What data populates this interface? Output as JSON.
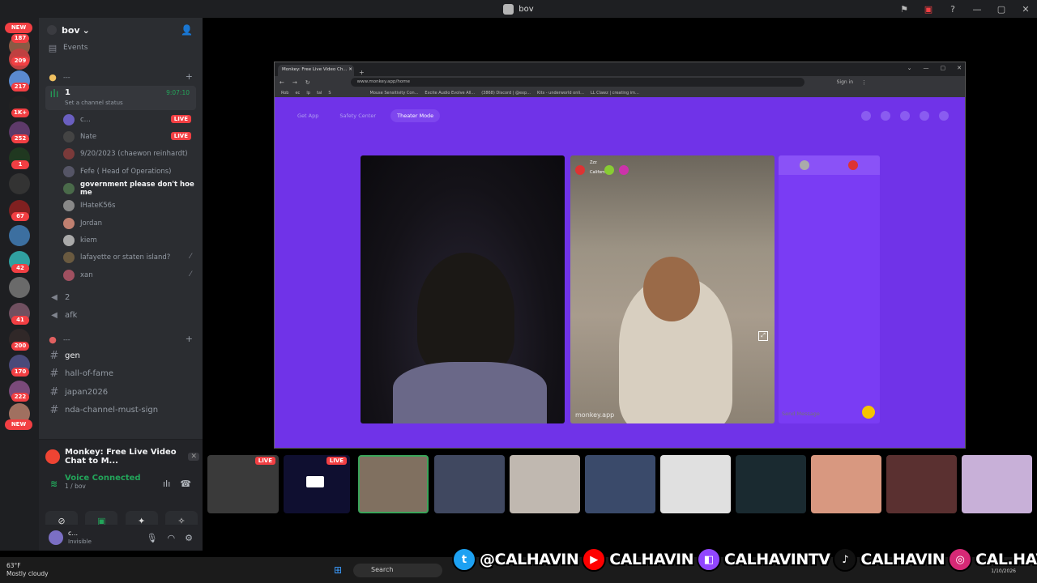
{
  "window": {
    "title": "bov"
  },
  "rail": {
    "badges": [
      "NEW",
      "187",
      "209",
      "217",
      "1K+",
      "252",
      "1",
      "67",
      "",
      "42",
      "",
      "41",
      "200",
      "170",
      "222",
      "NEW"
    ]
  },
  "sidebar": {
    "server_name": "bov",
    "events_label": "Events",
    "category1": "---",
    "category2": "---",
    "voice_channel_1": {
      "name": "1",
      "timer": "9:07:10",
      "status": "Set a channel status"
    },
    "members": [
      {
        "name": "c...",
        "live": "LIVE"
      },
      {
        "name": "Nate",
        "live": "LIVE"
      },
      {
        "name": "9/20/2023 (chaewon reinhardt)"
      },
      {
        "name": "Fefe ( Head of Operations)"
      },
      {
        "name": "government please don't hoe me"
      },
      {
        "name": "IHateK56s"
      },
      {
        "name": "Jordan"
      },
      {
        "name": "kiem"
      },
      {
        "name": "lafayette or staten island?"
      },
      {
        "name": "xan"
      }
    ],
    "voice_channels": [
      "2",
      "afk"
    ],
    "text_channels": [
      "gen",
      "hall-of-fame",
      "japan2026",
      "nda-channel-must-sign"
    ]
  },
  "voice_panel": {
    "activity": "Monkey: Free Live Video Chat to M...",
    "connected": "Voice Connected",
    "location": "1 / bov"
  },
  "user": {
    "name": "c...",
    "status": "Invisible"
  },
  "browser": {
    "tab_title": "Monkey: Free Live Video Ch...",
    "url": "www.monkey.app/home",
    "sign_in": "Sign in",
    "bookmarks": [
      "Rob",
      "ec",
      "lp",
      "tal",
      "S",
      "Mouse Sensitivity Con...",
      "Excite Audio Evolve All...",
      "(3868) Discord | @exp...",
      "Kits - underworld onli...",
      "LL Clawz | creating im..."
    ]
  },
  "monkey": {
    "nav": [
      "Get App",
      "Safety Center",
      "Theater Mode"
    ],
    "watermark": "monkey.app",
    "send_placeholder": "Send Message",
    "remote_user": "Zzz",
    "remote_loc": "California"
  },
  "stream_live": "LIVE",
  "taskbar": {
    "temp": "63°F",
    "weather": "Mostly cloudy",
    "search": "Search",
    "date": "1/10/2026"
  },
  "social": {
    "twitter": "@CALHAVIN",
    "youtube": "CALHAVIN",
    "twitch": "CALHAVINTV",
    "tiktok": "CALHAVIN",
    "instagram": "CAL.HAVIN"
  },
  "colors": {
    "discord_bg": "#2b2d31",
    "monkey_purple": "#7033e8",
    "live_red": "#f23f43",
    "voice_green": "#23a55a"
  }
}
